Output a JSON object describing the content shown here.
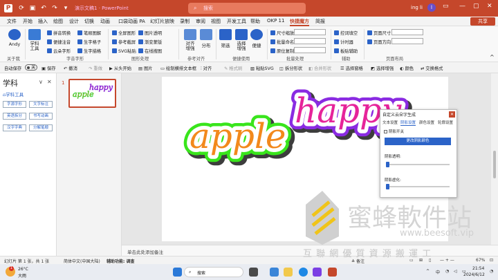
{
  "titlebar": {
    "file_name": "演示文稿1",
    "app": "PowerPoint",
    "search_placeholder": "搜索",
    "user": "ing li",
    "avatar_initial": "l"
  },
  "menu": {
    "items": [
      "文件",
      "开始",
      "插入",
      "绘图",
      "设计",
      "切换",
      "动画",
      "口袋动画 PA",
      "幻灯片放映",
      "录制",
      "审阅",
      "视图",
      "开发工具",
      "帮助",
      "OKP 11",
      "快捷魔方",
      "简报"
    ],
    "active_index": 15,
    "share": "共享"
  },
  "ribbon": {
    "andy": "Andy",
    "group_about": "关于我",
    "subject_tool": "学科\n工具",
    "char_buttons": [
      "拼音转换",
      "笔顺图解",
      "便捷注音",
      "生字格子",
      "云朵字形",
      "生字描格"
    ],
    "group_char": "字音字形",
    "shape_buttons": [
      "全屏图形",
      "图片透明",
      "参考截屏",
      "渐变蒙版",
      "SVG粘贴",
      "在线搜图"
    ],
    "group_shape": "图形处理",
    "align": "对齐\n增强",
    "distribute": "分布",
    "group_align": "参考对齐",
    "filter": "筛选",
    "select_enhance": "选择\n增强",
    "easy_use": "便捷",
    "group_easy": "便捷使用",
    "batch_buttons": [
      "尺寸缩放",
      "批量命名",
      "原位复制"
    ],
    "group_batch": "批量处理",
    "assist_buttons": [
      "控词填空",
      "计时器",
      "板贴辅助"
    ],
    "group_assist": "辅助",
    "page_buttons": [
      "页面尺寸",
      "页面方向"
    ],
    "group_page": "页面布局"
  },
  "qat": {
    "autosave": "自动保存",
    "toggle": "关",
    "items": [
      "保存",
      "撤消",
      "重做",
      "从头开始",
      "图片",
      "绘制横排文本框",
      "对齐",
      "格式刷",
      "粘贴SVG",
      "拆分形状",
      "合并形状",
      "选择窗格",
      "选择增强",
      "颜色",
      "交换格式"
    ]
  },
  "left_panel": {
    "title": "学科",
    "tool_link": "学科工具",
    "buttons": [
      "字源字形",
      "文字标注",
      "英语拆分",
      "书写动画",
      "汉字字典",
      "分解笔顺"
    ]
  },
  "thumb": {
    "number": "1"
  },
  "slide": {
    "word1": "apple",
    "word2": "happy"
  },
  "dialog": {
    "title": "自定义云朵字生成",
    "tabs": [
      "文本设置",
      "阴影设置",
      "颜色设置",
      "轮廓设置"
    ],
    "active_tab": 1,
    "shadow_toggle": "阴影开关",
    "change_color": "更改阴影颜色",
    "opacity_label": "阴影透明:",
    "blur_label": "阴影虚化:"
  },
  "notes": {
    "placeholder": "单击此处添加备注"
  },
  "status": {
    "slide_info": "幻灯片 第 1 张，共 1 张",
    "language": "简体中文(中国大陆)",
    "accessibility": "辅助功能: 调查",
    "notes": "备注",
    "zoom": "67%"
  },
  "taskbar": {
    "weather_temp": "26°C",
    "weather_desc": "大雨",
    "search": "搜索",
    "time": "21:54",
    "date": "2024/6/12",
    "ime": "中",
    "badge": "1"
  },
  "watermark": {
    "brand": "蜜蜂軟件站",
    "sub": "互 聯 網 優 質 資 源 搬 運 工",
    "url": "www.beesoft.vip"
  },
  "colors": {
    "accent": "#c5472b",
    "blue": "#2b63c8"
  }
}
